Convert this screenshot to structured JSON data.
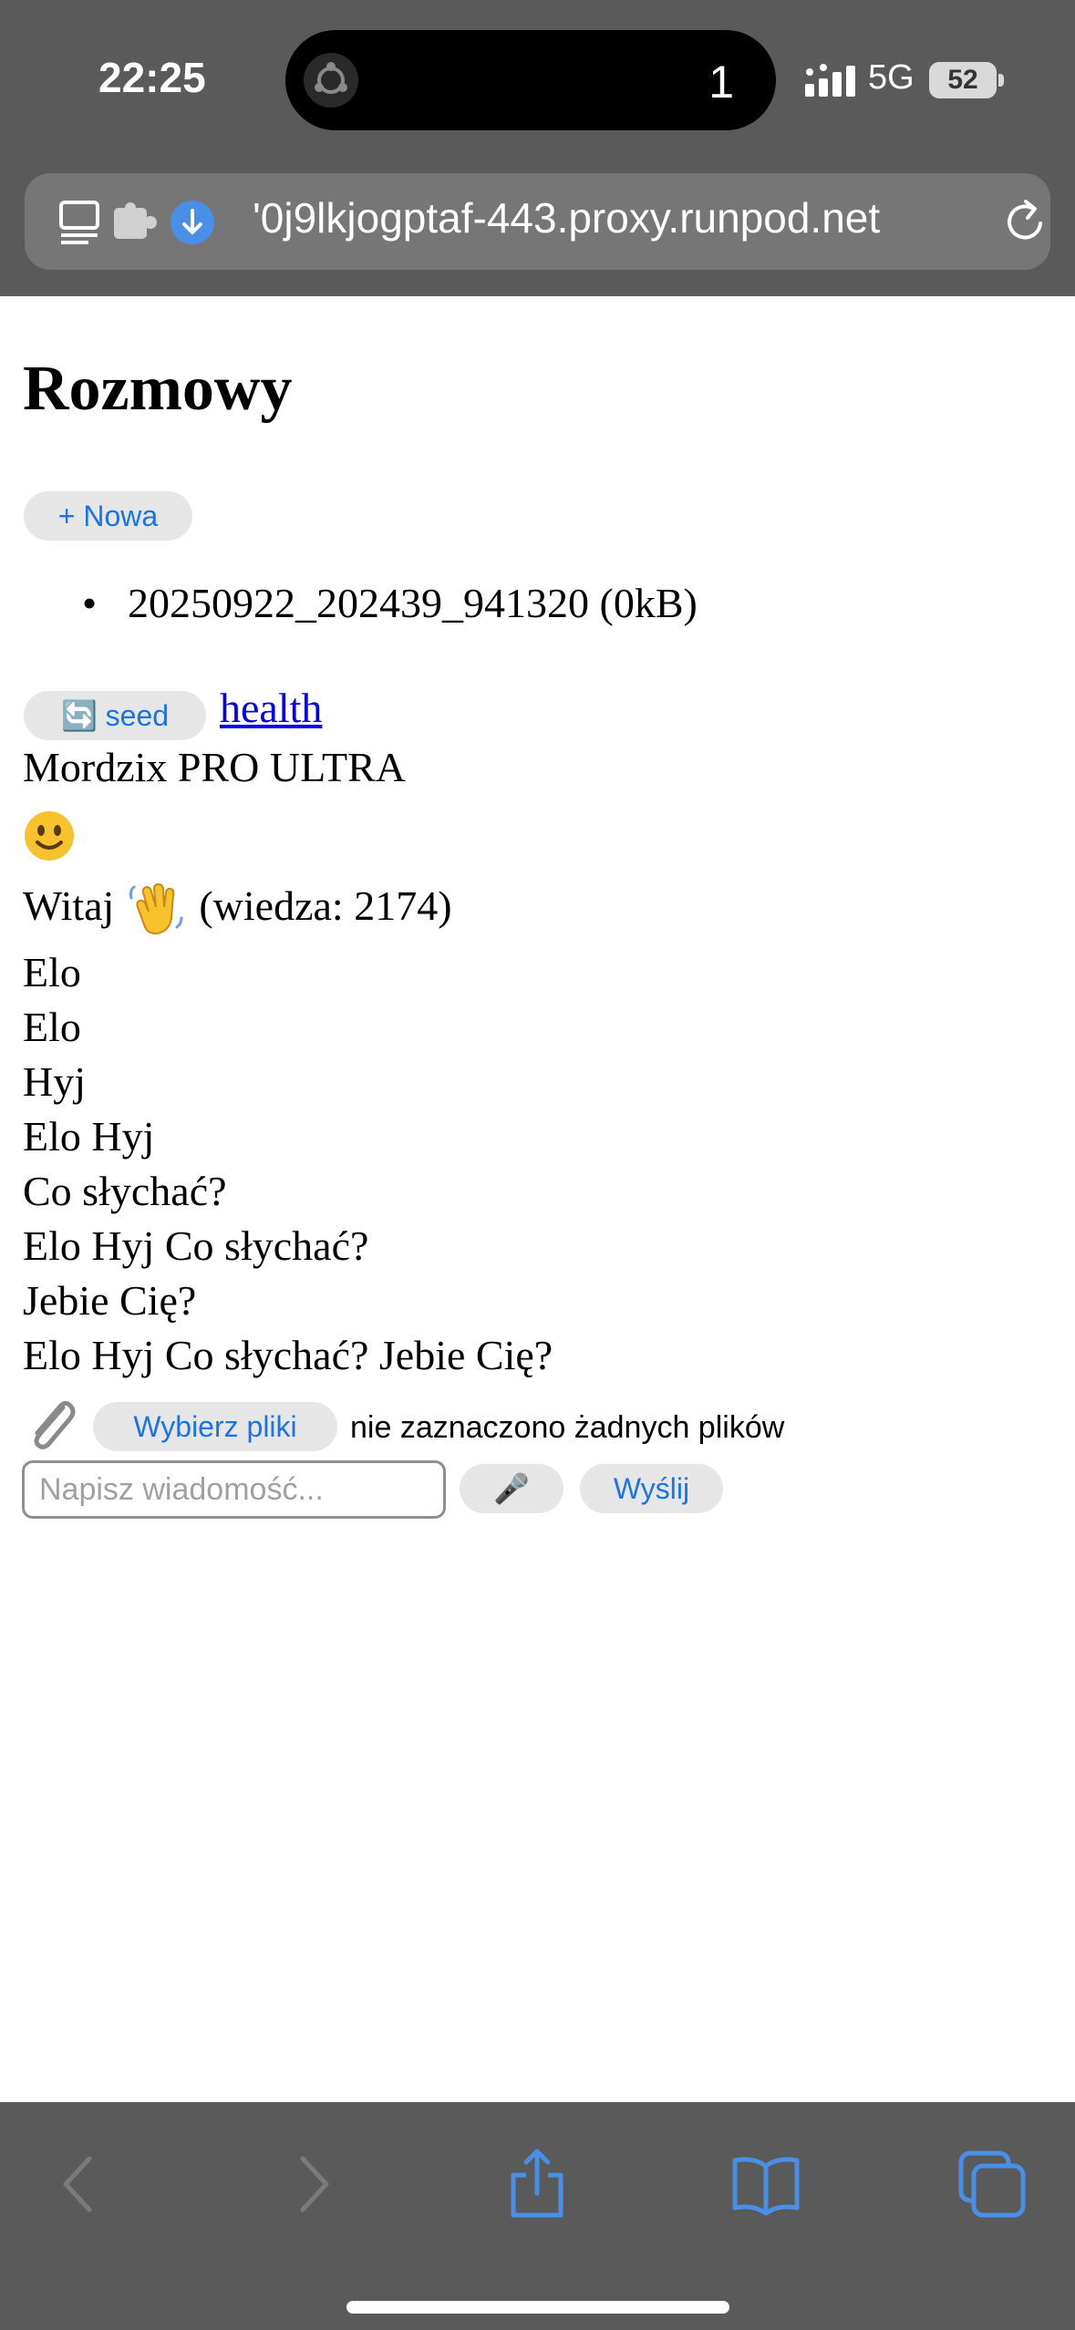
{
  "status_bar": {
    "time": "22:25",
    "island_count": "1",
    "network": "5G",
    "battery": "52"
  },
  "browser": {
    "url": "'0j9lkjogptaf-443.proxy.runpod.net"
  },
  "page": {
    "title": "Rozmowy",
    "new_button": "+ Nowa",
    "conversations": [
      "20250922_202439_941320 (0kB)"
    ],
    "seed_button": "🔄 seed",
    "health_link": "health",
    "model_name": "Mordzix PRO ULTRA",
    "greeting_prefix": "Witaj",
    "greeting_suffix": "(wiedza: 2174)",
    "messages": [
      "Elo",
      "Elo",
      "Hyj",
      "Elo Hyj",
      "Co słychać?",
      "Elo Hyj Co słychać?",
      "Jebie Cię?",
      "Elo Hyj Co słychać? Jebie Cię?"
    ],
    "file_button": "Wybierz pliki",
    "file_status": "nie zaznaczono żadnych plików",
    "message_placeholder": "Napisz wiadomość...",
    "mic_label": "🎤",
    "send_button": "Wyślij"
  },
  "icons": {
    "tabs_overview": "sidebar-icon",
    "extensions": "extension-icon",
    "download": "download-icon",
    "reload": "reload-icon",
    "back": "back-icon",
    "forward": "forward-icon",
    "share": "share-icon",
    "bookmarks": "bookmarks-icon",
    "tabs": "tabs-icon"
  },
  "colors": {
    "link": "#0000ee",
    "button_text": "#1a73e8",
    "toolbar_accent": "#4a8fe7"
  }
}
